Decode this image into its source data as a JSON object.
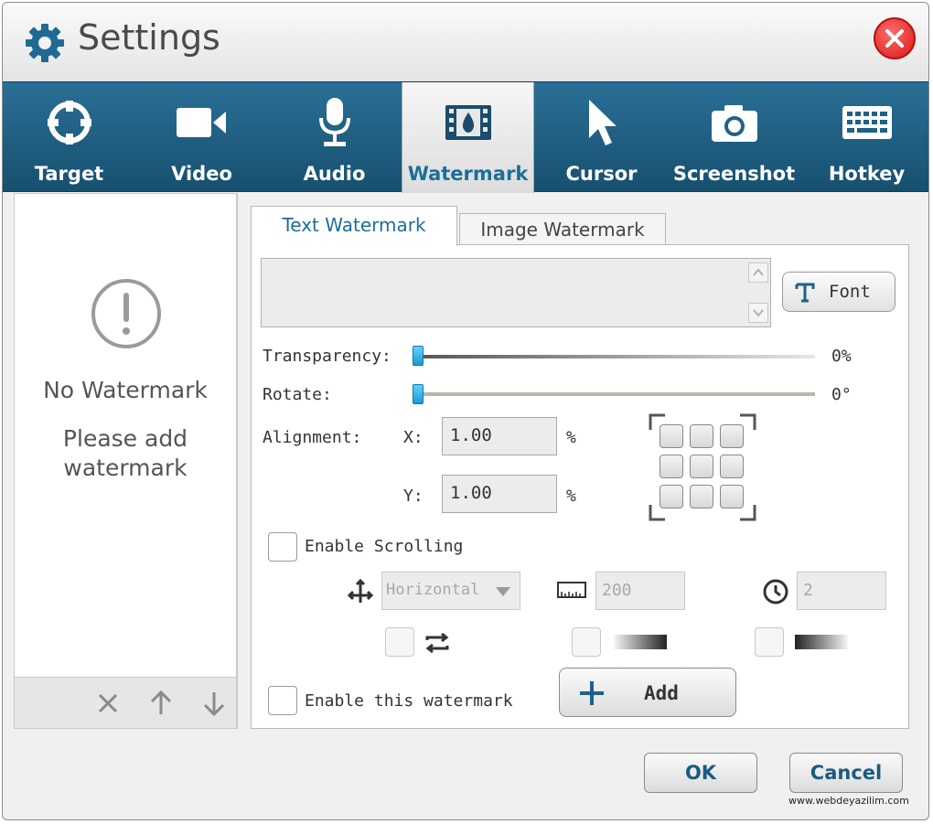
{
  "window": {
    "title": "Settings",
    "icon": "gear-icon",
    "close_icon": "close-icon"
  },
  "tabs": [
    {
      "label": "Target",
      "icon": "target-icon",
      "active": false
    },
    {
      "label": "Video",
      "icon": "video-camera-icon",
      "active": false
    },
    {
      "label": "Audio",
      "icon": "microphone-icon",
      "active": false
    },
    {
      "label": "Watermark",
      "icon": "film-drop-icon",
      "active": true
    },
    {
      "label": "Cursor",
      "icon": "cursor-icon",
      "active": false
    },
    {
      "label": "Screenshot",
      "icon": "camera-icon",
      "active": false
    },
    {
      "label": "Hotkey",
      "icon": "keyboard-icon",
      "active": false
    }
  ],
  "left_panel": {
    "empty_title": "No Watermark",
    "empty_line1": "Please add",
    "empty_line2": "watermark",
    "toolbar_icons": [
      "delete-icon",
      "move-up-icon",
      "move-down-icon"
    ]
  },
  "subtabs": {
    "text": "Text Watermark",
    "image": "Image Watermark"
  },
  "text_watermark": {
    "text_value": "",
    "font_button": "Font",
    "transparency_label": "Transparency:",
    "transparency_value": "0%",
    "transparency_level": 0,
    "rotate_label": "Rotate:",
    "rotate_value": "0°",
    "rotate_level": 0,
    "alignment_label": "Alignment:",
    "x_label": "X:",
    "x_value": "1.00",
    "x_unit": "%",
    "y_label": "Y:",
    "y_value": "1.00",
    "y_unit": "%",
    "enable_scrolling_label": "Enable Scrolling",
    "enable_scrolling_checked": false,
    "direction_value": "Horizontal",
    "speed_value": "200",
    "interval_value": "2",
    "enable_watermark_label": "Enable this watermark",
    "enable_watermark_checked": false,
    "add_button": "Add"
  },
  "footer": {
    "ok_button": "OK",
    "cancel_button": "Cancel",
    "credit": "www.webdeyazilim.com"
  },
  "colors": {
    "tabbar": "#1f6186",
    "accent": "#1b6f9a",
    "close": "#d81919"
  }
}
